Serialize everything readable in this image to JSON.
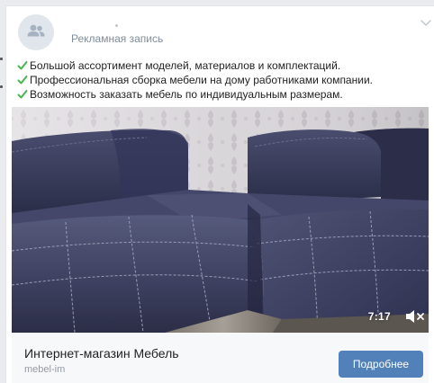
{
  "header": {
    "label": "Рекламная запись",
    "avatar_icon": "users-icon",
    "menu_icon": "chevron-down-icon"
  },
  "post": {
    "lines": [
      "Большой ассортимент моделей, материалов и комплектаций.",
      "Профессиональная сборка мебели на дому работниками компании.",
      "Возможность заказать мебель по индивидуальным размерам."
    ],
    "check_color": "#4bb34b"
  },
  "video": {
    "duration": "7:17",
    "mute_icon": "speaker-muted-icon"
  },
  "ad": {
    "title": "Интернет-магазин Мебель",
    "domain": "mebel-im",
    "button_label": "Подробнее",
    "accent": "#5181b8"
  }
}
